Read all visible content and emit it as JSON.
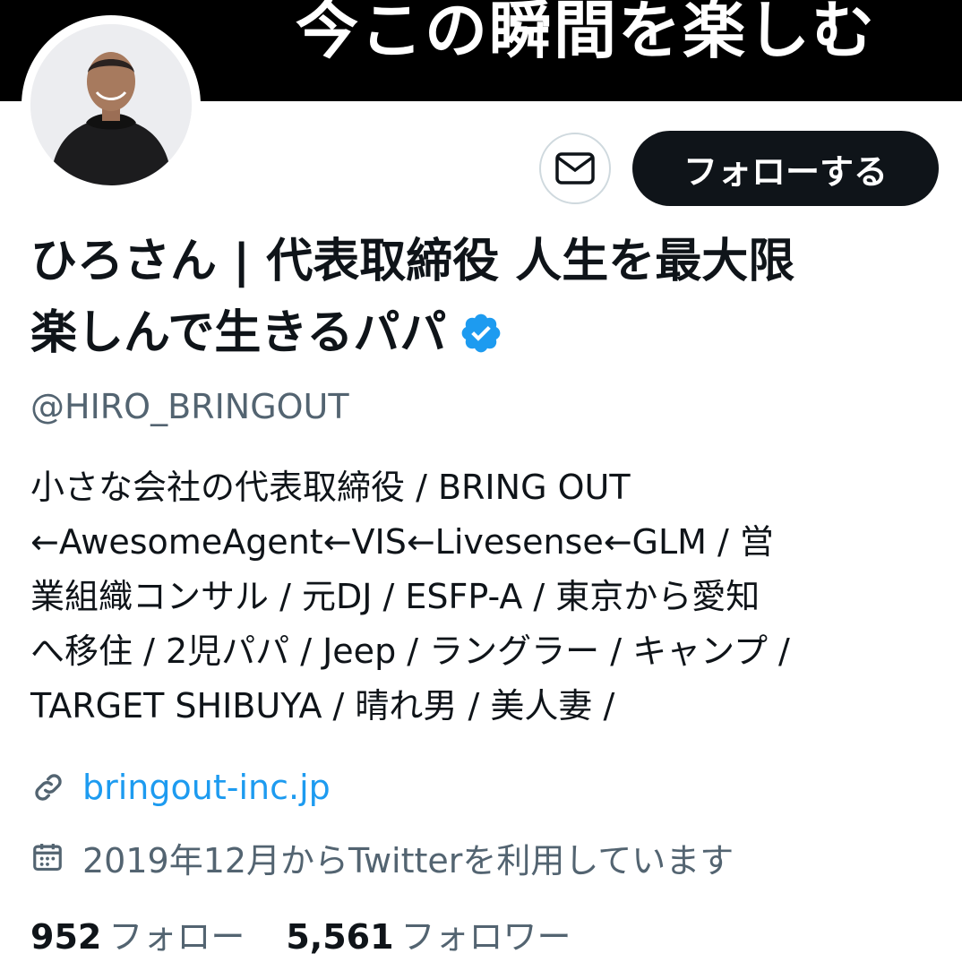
{
  "banner": {
    "text": "今この瞬間を楽しむ"
  },
  "actions": {
    "follow_label": "フォローする",
    "message_icon": "envelope-icon"
  },
  "profile": {
    "name_line1": "ひろさん | 代表取締役 人生を最大限",
    "name_line2": "楽しんで生きるパパ",
    "verified_icon": "verified-badge-icon",
    "handle": "@HIRO_BRINGOUT",
    "bio_lines": [
      "小さな会社の代表取締役 / BRING OUT",
      "←AwesomeAgent←VIS←Livesense←GLM / 営",
      "業組織コンサル / 元DJ / ESFP-A / 東京から愛知",
      "へ移住 / 2児パパ / Jeep / ラングラー / キャンプ /",
      "TARGET SHIBUYA / 晴れ男 / 美人妻 /"
    ],
    "website": "bringout-inc.jp",
    "joined": "2019年12月からTwitterを利用しています"
  },
  "stats": {
    "following_count": "952",
    "following_label": "フォロー",
    "followers_count": "5,561",
    "followers_label": "フォロワー"
  },
  "colors": {
    "accent": "#1d9bf0",
    "text": "#0f1419",
    "secondary": "#536471",
    "banner": "#000000"
  }
}
